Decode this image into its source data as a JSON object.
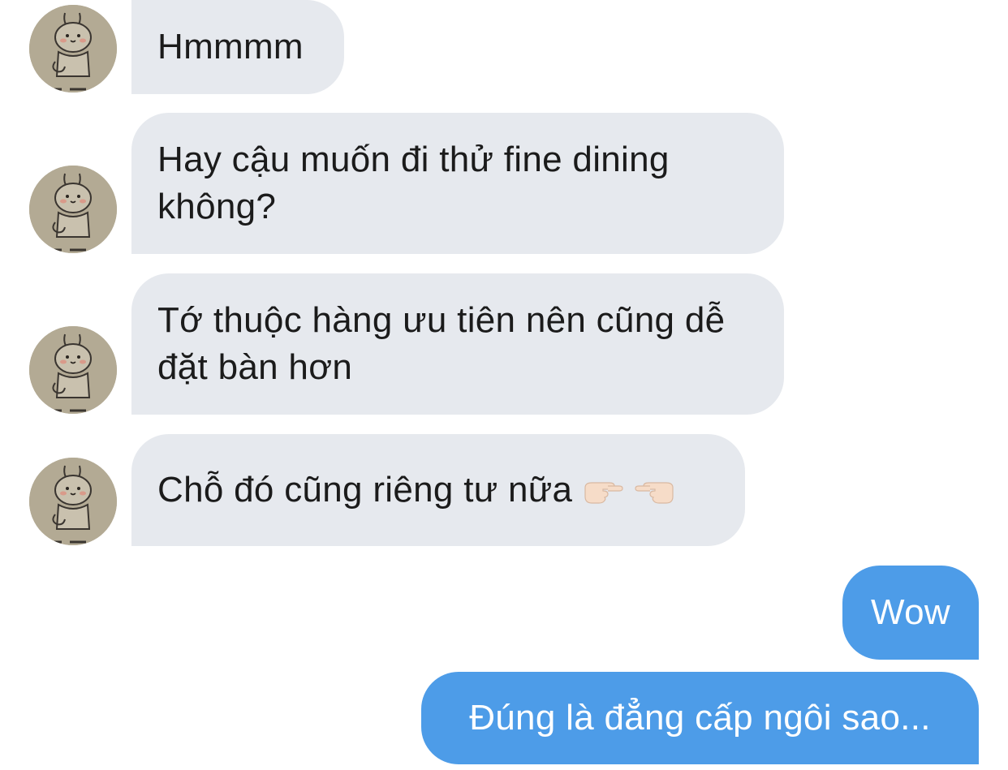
{
  "messages": [
    {
      "sender": "other",
      "text": "Hmmmm"
    },
    {
      "sender": "other",
      "text": "Hay cậu muốn đi thử fine dining không?"
    },
    {
      "sender": "other",
      "text": "Tớ thuộc hàng ưu tiên nên cũng dễ đặt bàn hơn"
    },
    {
      "sender": "other",
      "text": "Chỗ đó cũng riêng tư nữa",
      "emoji": [
        "pointing-right-emoji",
        "pointing-left-emoji"
      ]
    },
    {
      "sender": "me",
      "text": "Wow"
    },
    {
      "sender": "me",
      "text": "Đúng là đẳng cấp ngôi sao..."
    }
  ],
  "colors": {
    "incoming_bubble": "#e6e9ee",
    "outgoing_bubble": "#4d9ce8",
    "incoming_text": "#1b1b1b",
    "outgoing_text": "#ffffff"
  },
  "avatar": {
    "icon": "bunny-avatar-icon"
  }
}
